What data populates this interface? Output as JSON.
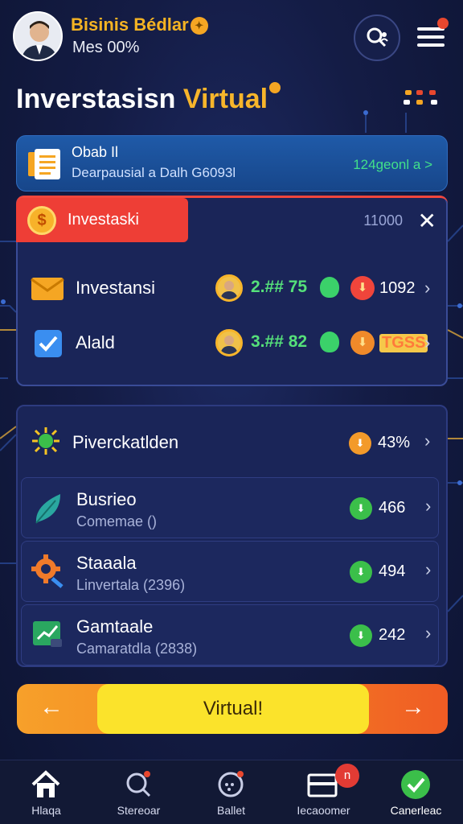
{
  "colors": {
    "accent_gold": "#f7b52b",
    "accent_red": "#ee3e36",
    "accent_green": "#55e07a",
    "background": "#141c45",
    "cta_yellow": "#fbe32b"
  },
  "header": {
    "brand": "Bisinis Bédlar",
    "subtitle": "Mes 00%",
    "search_icon": "search-user-icon",
    "menu_icon": "hamburger-menu-icon"
  },
  "page_title": {
    "main": "Inverstasisn",
    "accent": "Virtual"
  },
  "summary": {
    "title": "Obab Il",
    "subtitle": "Dearpausial a Dalh G6093l",
    "link": "124geonl a >"
  },
  "invest_panel": {
    "tab_label": "Investaski",
    "count": "11000",
    "close": "✕",
    "rows": [
      {
        "label": "Investansi",
        "icon": "envelope-icon",
        "value": "2.## 75",
        "number": "1092"
      },
      {
        "label": "Alald",
        "icon": "checkbox-icon",
        "value": "3.## 82",
        "number": "TGSS"
      }
    ]
  },
  "list": {
    "items": [
      {
        "title": "Piverckatlden",
        "subtitle": "",
        "value": "43%",
        "icon": "virus-icon",
        "dot_color": "#f39a2a"
      },
      {
        "title": "Busrieo",
        "subtitle": "Comemae ()",
        "value": "466",
        "icon": "leaf-icon",
        "dot_color": "#3bbf4a"
      },
      {
        "title": "Staaala",
        "subtitle": "Linvertala (2396)",
        "value": "494",
        "icon": "gear-icon",
        "dot_color": "#3bbf4a"
      },
      {
        "title": "Gamtaale",
        "subtitle": "Camaratdla (2838)",
        "value": "242",
        "icon": "chart-icon",
        "dot_color": "#3bbf4a"
      }
    ]
  },
  "cta": {
    "left": "←",
    "label": "Virtual!",
    "right": "→"
  },
  "nav": {
    "items": [
      {
        "label": "Hlaqa",
        "icon": "home-icon"
      },
      {
        "label": "Stereoar",
        "icon": "search-icon"
      },
      {
        "label": "Ballet",
        "icon": "wallet-icon"
      },
      {
        "label": "Iecaoomer",
        "icon": "card-icon",
        "badge": "n"
      },
      {
        "label": "Canerleac",
        "icon": "support-icon"
      }
    ]
  }
}
